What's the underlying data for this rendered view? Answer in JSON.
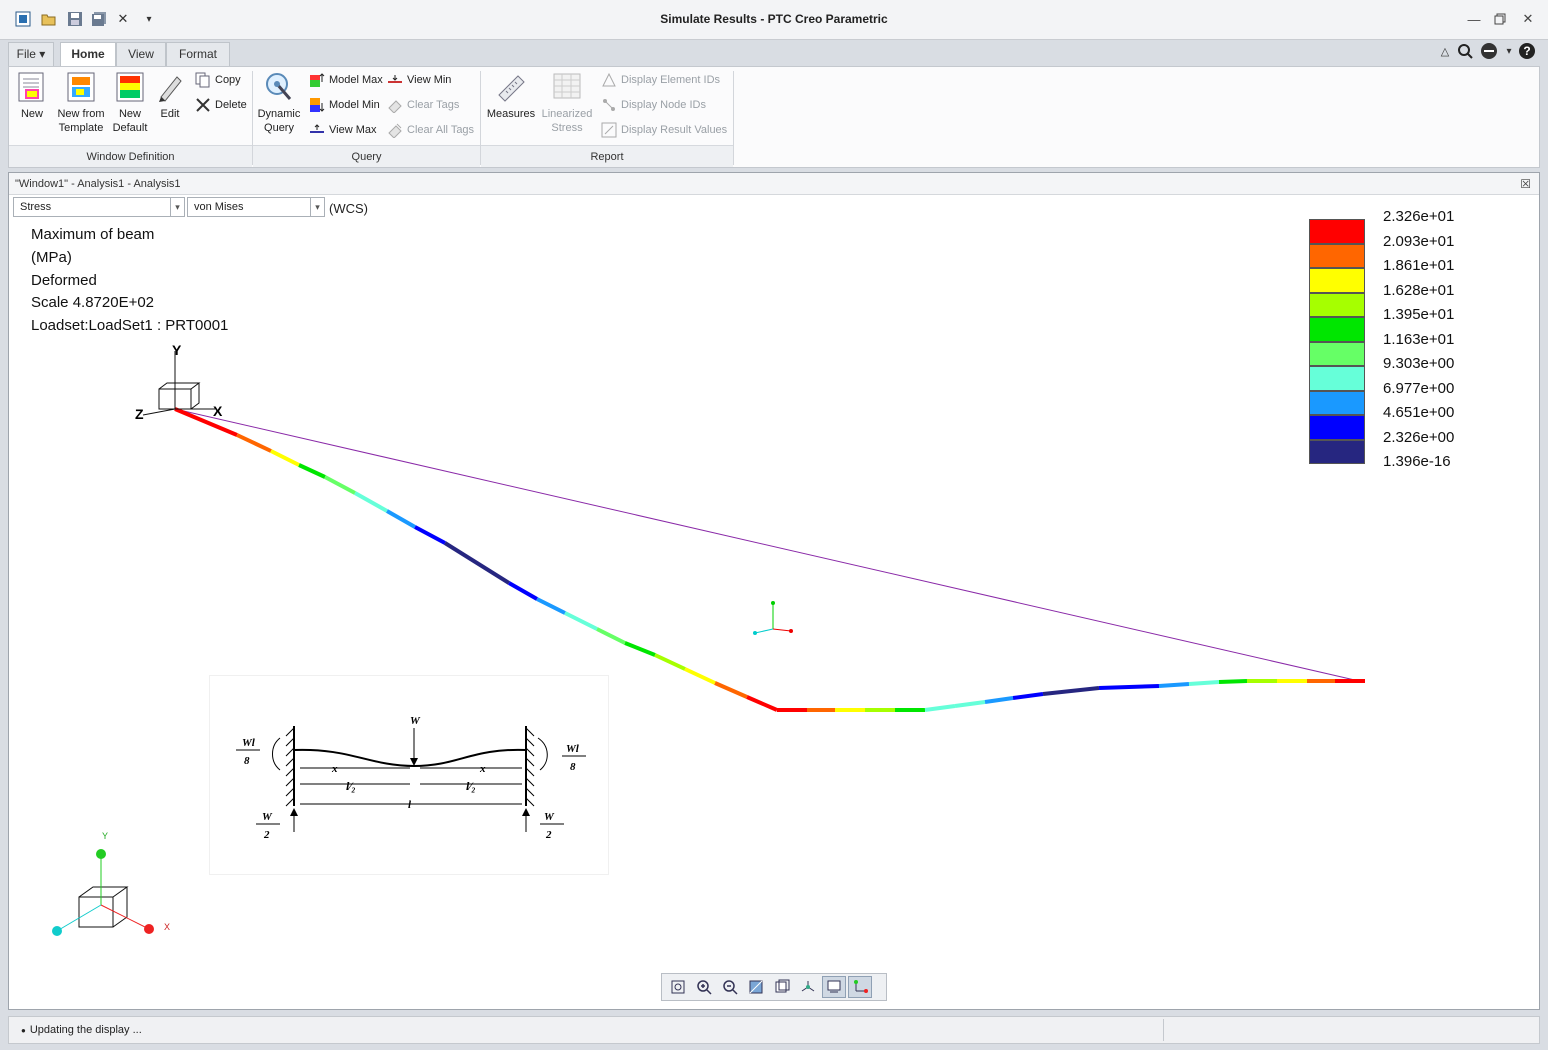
{
  "window": {
    "title": "Simulate Results - PTC Creo Parametric"
  },
  "quick_access": {
    "icons": [
      "app-icon",
      "open-icon",
      "save-icon",
      "save-copy-icon",
      "close-window-icon",
      "customize-dropdown-icon"
    ]
  },
  "tabs": [
    {
      "label": "File ▾"
    },
    {
      "label": "Home"
    },
    {
      "label": "View"
    },
    {
      "label": "Format"
    }
  ],
  "ribbon": {
    "window_definition": {
      "label": "Window Definition",
      "new": "New",
      "new_from_template_1": "New from",
      "new_from_template_2": "Template",
      "new_default_1": "New",
      "new_default_2": "Default",
      "edit": "Edit",
      "copy": "Copy",
      "delete": "Delete"
    },
    "query": {
      "label": "Query",
      "dynamic_query_1": "Dynamic",
      "dynamic_query_2": "Query",
      "model_max": "Model Max",
      "model_min": "Model Min",
      "view_max": "View Max",
      "view_min": "View Min",
      "clear_tags": "Clear Tags",
      "clear_all_tags": "Clear All Tags"
    },
    "report": {
      "label": "Report",
      "measures": "Measures",
      "linearized_1": "Linearized",
      "linearized_2": "Stress",
      "display_element_ids": "Display Element IDs",
      "display_node_ids": "Display Node IDs",
      "display_result_values": "Display Result Values"
    }
  },
  "graphics_window": {
    "title": "\"Window1\" - Analysis1 - Analysis1",
    "quantity_select": "Stress",
    "component_select": "von Mises",
    "csys_label": "(WCS)",
    "info_lines": [
      "Maximum of beam",
      "(MPa)",
      "Deformed",
      "Scale  4.8720E+02",
      "Loadset:LoadSet1 :  PRT0001"
    ],
    "axis_labels": {
      "y": "Y",
      "x": "X",
      "z": "Z",
      "tri_y": "Y",
      "tri_x": "X"
    },
    "legend": {
      "colors": [
        "#ff0000",
        "#ff6600",
        "#ffff00",
        "#a6ff00",
        "#00e600",
        "#66ff66",
        "#66ffd9",
        "#1a99ff",
        "#0000ff",
        "#262680"
      ],
      "values": [
        "2.326e+01",
        "2.093e+01",
        "1.861e+01",
        "1.628e+01",
        "1.395e+01",
        "1.163e+01",
        "9.303e+00",
        "6.977e+00",
        "4.651e+00",
        "2.326e+00",
        "1.396e-16"
      ]
    },
    "sketch_labels": {
      "w_top": "W",
      "wl_left_num": "Wl",
      "wl_left_den": "8",
      "wl_right_num": "Wl",
      "wl_right_den": "8",
      "x_left": "x",
      "x_right": "x",
      "half_left": "l⁄₂",
      "half_right": "l⁄₂",
      "l_full": "l",
      "w2_left_num": "W",
      "w2_left_den": "2",
      "w2_right_num": "W",
      "w2_right_den": "2"
    }
  },
  "view_toolbar": {
    "icons": [
      "refit-icon",
      "zoom-in-icon",
      "zoom-out-icon",
      "repaint-icon",
      "saved-views-icon",
      "spin-center-icon",
      "annotation-display-icon",
      "csys-display-icon"
    ]
  },
  "status": {
    "message": "Updating the display ..."
  }
}
